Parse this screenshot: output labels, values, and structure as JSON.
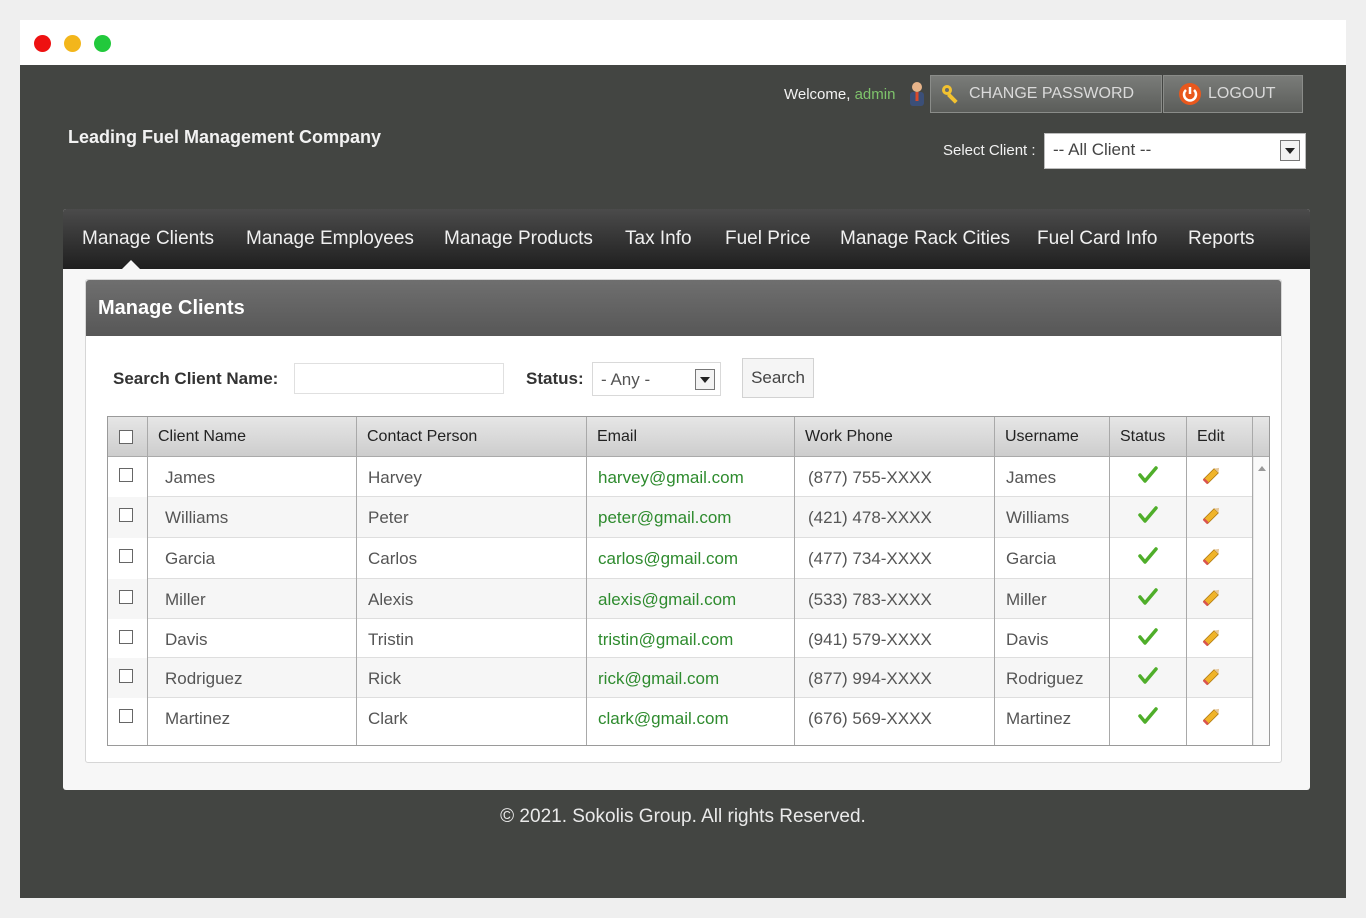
{
  "header": {
    "company": "Leading Fuel Management Company",
    "welcome_text": "Welcome,",
    "username": "admin",
    "change_password": "CHANGE PASSWORD",
    "logout": "LOGOUT",
    "select_client_label": "Select Client :",
    "select_client_value": "-- All Client --"
  },
  "nav": {
    "items": [
      "Manage Clients",
      "Manage Employees",
      "Manage Products",
      "Tax Info",
      "Fuel Price",
      "Manage Rack Cities",
      "Fuel Card Info",
      "Reports"
    ],
    "active": "Manage Clients"
  },
  "panel": {
    "title": "Manage Clients",
    "search_label": "Search Client Name:",
    "search_value": "",
    "status_label": "Status:",
    "status_value": "- Any -",
    "search_button": "Search"
  },
  "table": {
    "columns": [
      "Client Name",
      "Contact Person",
      "Email",
      "Work Phone",
      "Username",
      "Status",
      "Edit"
    ],
    "rows": [
      {
        "client": "James",
        "contact": "Harvey",
        "email": "harvey@gmail.com",
        "phone": "(877) 755-XXXX",
        "username": "James",
        "status_icon": "check-icon",
        "edit_icon": "pencil-icon"
      },
      {
        "client": "Williams",
        "contact": "Peter",
        "email": "peter@gmail.com",
        "phone": "(421) 478-XXXX",
        "username": "Williams",
        "status_icon": "check-icon",
        "edit_icon": "pencil-icon"
      },
      {
        "client": "Garcia",
        "contact": "Carlos",
        "email": "carlos@gmail.com",
        "phone": "(477) 734-XXXX",
        "username": "Garcia",
        "status_icon": "check-icon",
        "edit_icon": "pencil-icon"
      },
      {
        "client": "Miller",
        "contact": "Alexis",
        "email": "alexis@gmail.com",
        "phone": "(533) 783-XXXX",
        "username": "Miller",
        "status_icon": "check-icon",
        "edit_icon": "pencil-icon"
      },
      {
        "client": "Davis",
        "contact": "Tristin",
        "email": "tristin@gmail.com",
        "phone": "(941) 579-XXXX",
        "username": "Davis",
        "status_icon": "check-icon",
        "edit_icon": "pencil-icon"
      },
      {
        "client": "Rodriguez",
        "contact": "Rick",
        "email": "rick@gmail.com",
        "phone": "(877) 994-XXXX",
        "username": "Rodriguez",
        "status_icon": "check-icon",
        "edit_icon": "pencil-icon"
      },
      {
        "client": "Martinez",
        "contact": "Clark",
        "email": "clark@gmail.com",
        "phone": "(676) 569-XXXX",
        "username": "Martinez",
        "status_icon": "check-icon",
        "edit_icon": "pencil-icon"
      }
    ]
  },
  "footer": {
    "copyright": "© 2021. Sokolis Group. All rights Reserved."
  },
  "colors": {
    "page_bg": "#434542",
    "email": "#2e8b2e",
    "admin": "#7ec36b",
    "nav_bg": "#1f1f1f"
  }
}
